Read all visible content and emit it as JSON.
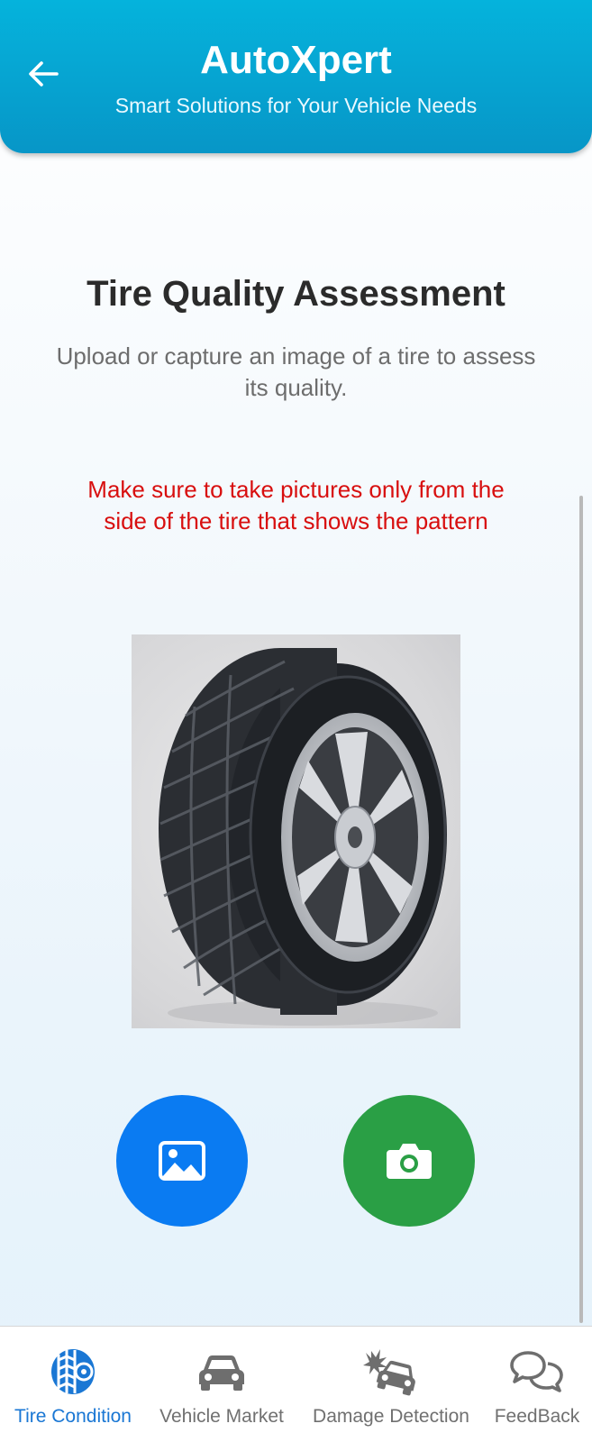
{
  "header": {
    "title": "AutoXpert",
    "subtitle": "Smart Solutions for Your Vehicle Needs",
    "back_icon": "arrow-left-icon"
  },
  "main": {
    "title": "Tire Quality Assessment",
    "description": "Upload or capture an image of a tire to assess its quality.",
    "warning": "Make sure to take pictures only from the side of the tire that shows the pattern",
    "image": "tire-photo",
    "actions": [
      {
        "name": "gallery",
        "icon": "image-icon",
        "color": "#0a7bf2"
      },
      {
        "name": "camera",
        "icon": "camera-icon",
        "color": "#2a9f45"
      }
    ]
  },
  "colors": {
    "header_accent": "#05b3dc",
    "active_tab": "#1a77d4",
    "inactive_tab": "#707070",
    "warning": "#d80f0f"
  },
  "nav": {
    "items": [
      {
        "label": "Tire Condition",
        "icon": "tire-icon",
        "active": true
      },
      {
        "label": "Vehicle Market",
        "icon": "car-icon",
        "active": false
      },
      {
        "label": "Damage Detection",
        "icon": "car-crash-icon",
        "active": false
      },
      {
        "label": "FeedBack",
        "icon": "chat-bubbles-icon",
        "active": false
      }
    ]
  }
}
